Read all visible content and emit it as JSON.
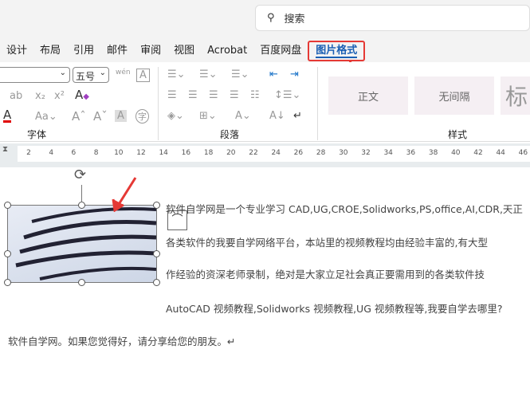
{
  "search": {
    "label": "搜索"
  },
  "tabs": [
    "设计",
    "布局",
    "引用",
    "邮件",
    "审阅",
    "视图",
    "Acrobat",
    "百度网盘",
    "图片格式"
  ],
  "font": {
    "size": "五号",
    "group_label": "字体",
    "font_color": "#e00000"
  },
  "paragraph": {
    "group_label": "段落"
  },
  "styles": {
    "items": [
      "正文",
      "无间隔",
      "标"
    ],
    "group_label": "样式"
  },
  "ruler": [
    "2",
    "4",
    "6",
    "8",
    "10",
    "12",
    "14",
    "16",
    "18",
    "20",
    "22",
    "24",
    "26",
    "28",
    "30",
    "32",
    "34",
    "36",
    "38",
    "40",
    "42",
    "44",
    "46"
  ],
  "document": {
    "lines": [
      "软件自学网是一个专业学习 CAD,UG,CROE,Solidworks,PS,office,AI,CDR,天正",
      "各类软件的我要自学网络平台，本站里的视频教程均由经验丰富的,有大型",
      "作经验的资深老师录制，绝对是大家立足社会真正要需用到的各类软件技",
      "AutoCAD 视频教程,Solidworks 视频教程,UG 视频教程等,我要自学去哪里?",
      "软件自学网。如果您觉得好，请分享给您的朋友。↵"
    ]
  },
  "accent": "#e53935"
}
